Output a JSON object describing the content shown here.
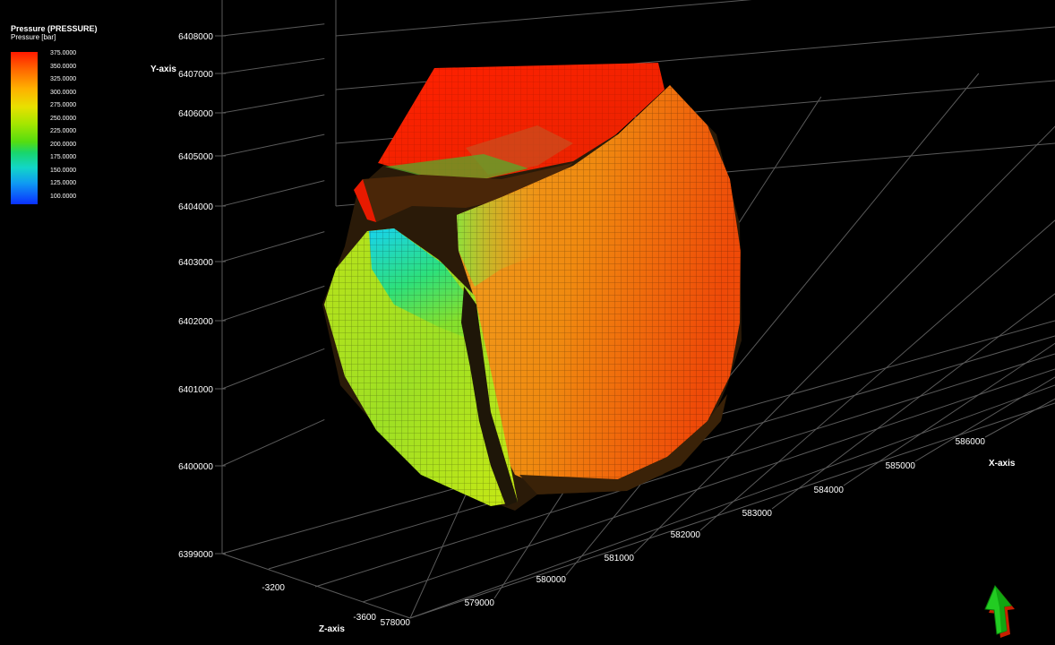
{
  "legend": {
    "title": "Pressure (PRESSURE)",
    "subtitle": "Pressure [bar]",
    "ticks": [
      "375.0000",
      "350.0000",
      "325.0000",
      "300.0000",
      "275.0000",
      "250.0000",
      "225.0000",
      "200.0000",
      "175.0000",
      "150.0000",
      "125.0000",
      "100.0000"
    ]
  },
  "axes": {
    "y_title": "Y-axis",
    "x_title": "X-axis",
    "z_title": "Z-axis",
    "y_ticks": [
      "6408000",
      "6407000",
      "6406000",
      "6405000",
      "6404000",
      "6403000",
      "6402000",
      "6401000",
      "6400000",
      "6399000"
    ],
    "x_ticks": [
      "578000",
      "579000",
      "580000",
      "581000",
      "582000",
      "583000",
      "584000",
      "585000",
      "586000"
    ],
    "z_ticks": [
      "-3200",
      "-3600"
    ]
  },
  "colors": {
    "background": "#000000",
    "grid": "#5a5a5a",
    "high_pressure": "#ff1a00",
    "low_pressure": "#0a30ff"
  },
  "navigation": {
    "icon": "green-arrow-icon"
  }
}
